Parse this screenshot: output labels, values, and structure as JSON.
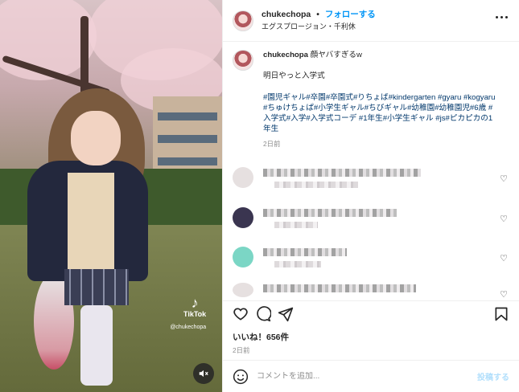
{
  "post": {
    "username": "chukechopa",
    "separator": "•",
    "follow_label": "フォローする",
    "location": "エグスプロージョン・千利休",
    "more_icon": "more-horizontal-icon"
  },
  "caption": {
    "username": "chukechopa",
    "text": "顔ヤバすぎるw",
    "line2": "明日やっと入学式",
    "hashtags": "#園児ギャル#卒園#卒園式#りちょば#kindergarten #gyaru #kogyaru #ちゅけちょぱ#小学生ギャル#ちびギャル#幼稚園#幼稚園児#6歳 #入学式#入学#入学式コーデ #1年生#小学生ギャル #js#ピカピカの1年生",
    "age": "2日前"
  },
  "comments": [
    {
      "heart_icon": "heart-outline-icon"
    },
    {
      "heart_icon": "heart-outline-icon"
    },
    {
      "heart_icon": "heart-outline-icon"
    },
    {
      "heart_icon": "heart-outline-icon"
    }
  ],
  "actions": {
    "like_icon": "heart-icon",
    "comment_icon": "comment-bubble-icon",
    "share_icon": "paper-plane-icon",
    "save_icon": "bookmark-icon"
  },
  "likes": "いいね！656件",
  "posted": "2日前",
  "composer": {
    "placeholder": "コメントを追加...",
    "post_label": "投稿する",
    "emoji_icon": "emoji-smile-icon"
  },
  "media": {
    "watermark_brand": "TikTok",
    "watermark_user": "@chukechopa",
    "mute_icon": "speaker-muted-icon"
  },
  "colors": {
    "accent": "#0095f6",
    "hashtag": "#00376b",
    "post_disabled": "#b2dffc",
    "muted_text": "#8e8e8e"
  }
}
